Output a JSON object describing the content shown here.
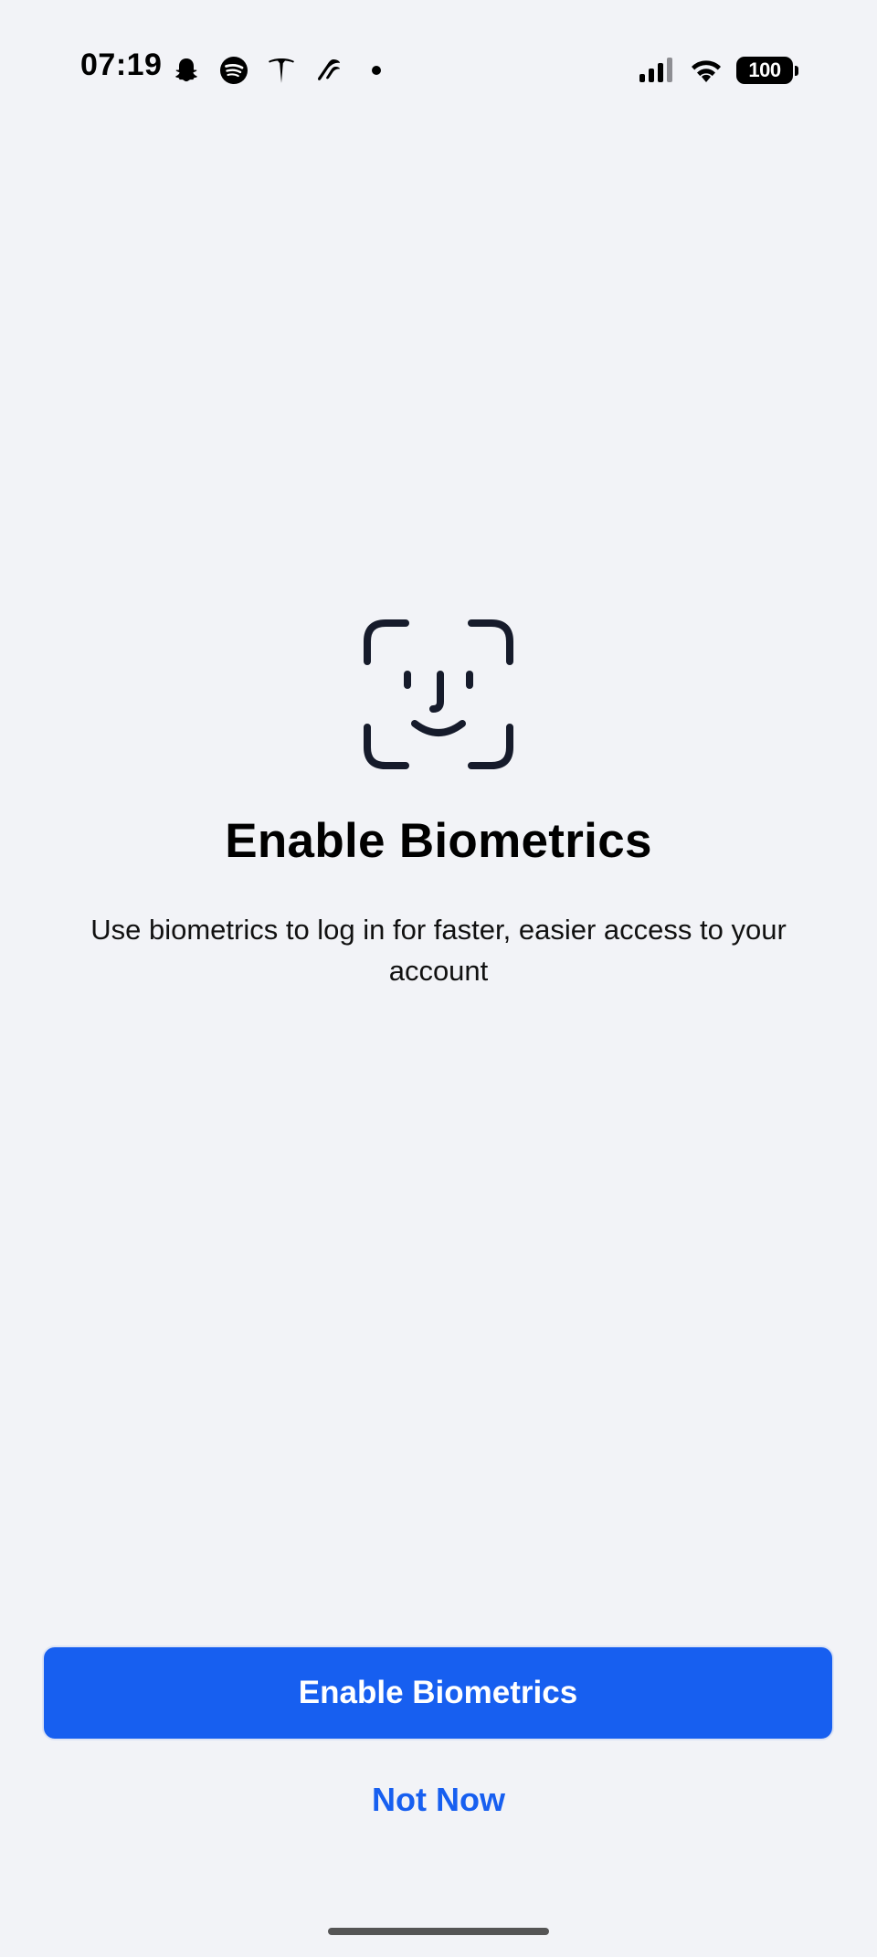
{
  "status_bar": {
    "time": "07:19",
    "battery": "100",
    "left_icons": [
      "snapchat-icon",
      "spotify-icon",
      "tesla-icon",
      "app-icon",
      "dot-icon"
    ],
    "right_icons": [
      "signal-icon",
      "wifi-icon",
      "battery-icon"
    ]
  },
  "main": {
    "icon": "face-id-icon",
    "title": "Enable Biometrics",
    "subtitle": "Use biometrics to log in for faster, easier access to your account"
  },
  "actions": {
    "enable_label": "Enable Biometrics",
    "not_now_label": "Not Now"
  },
  "colors": {
    "accent": "#175ff0",
    "background": "#f2f3f7",
    "icon_dark": "#161b2b"
  }
}
